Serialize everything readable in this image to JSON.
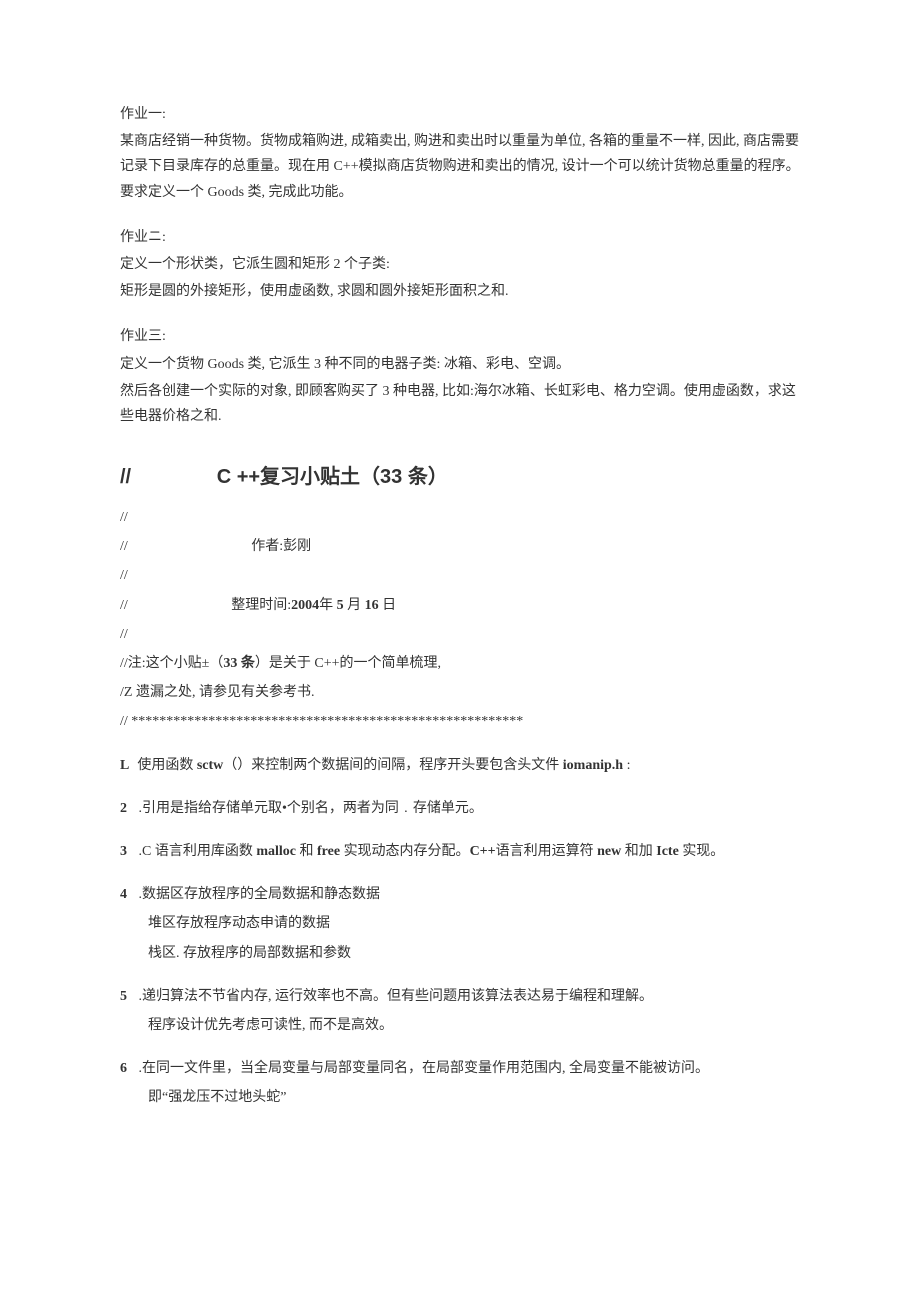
{
  "hw1": {
    "title": "作业一:",
    "body": "某商店经销一种货物。货物成箱购进, 成箱卖出, 购进和卖出时以重量为单位, 各箱的重量不一样, 因此, 商店需要记录下目录库存的总重量。现在用 C++模拟商店货物购进和卖出的情况, 设计一个可以统计货物总重量的程序。要求定义一个 Goods 类, 完成此功能。"
  },
  "hw2": {
    "title": "作业ニ:",
    "line1": "定义一个形状类，它派生圆和矩形 2 个子类:",
    "line2": "矩形是圆的外接矩形，使用虚函数, 求圆和圆外接矩形面积之和."
  },
  "hw3": {
    "title": "作业三:",
    "line1": "定义一个货物 Goods 类, 它派生 3 种不同的电器子类: 冰箱、彩电、空调。",
    "line2": "然后各创建一个实际的对象, 即顾客购买了 3 种电器, 比如:海尔冰箱、长虹彩电、格力空调。使用虚函数，求这些电器价格之和."
  },
  "tips": {
    "main_prefix": "//",
    "main_title": "C ++复习小贴土（33 条）",
    "slash1": "//",
    "author_line_prefix": " //",
    "author_text": "作者:彭刚",
    "slash2": "//",
    "time_prefix": "//",
    "time_label": "整理时间:",
    "time_value": "2004年 5 月 16 日",
    "slash3": "//",
    "note_prefix": "//注:这个小贴±（",
    "note_bold": "33 条",
    "note_suffix": "）是关于 C++的一个简单梳理,",
    "note2": "/Z 遗漏之处, 请参见有关参考书.",
    "stars": " // ********************************************************"
  },
  "items": [
    {
      "num": "L",
      "main_parts": [
        "使用函数 ",
        "sctw",
        "（）来控制两个数据间的间隔，程序开头要包含头文件 ",
        "iomanip.h",
        " :"
      ],
      "subs": []
    },
    {
      "num": "2",
      "main_parts": [
        " .引用是指给存储单元取•个别名，两者为同﹒存储单元。"
      ],
      "subs": []
    },
    {
      "num": "3",
      "main_parts": [
        " .C 语言利用库函数 ",
        "malloc",
        " 和 ",
        "free",
        " 实现动态内存分配。",
        "C++",
        "语言利用运算符 ",
        "new",
        " 和加 ",
        "Icte",
        " 实现。"
      ],
      "subs": []
    },
    {
      "num": "4",
      "main_parts": [
        " .数据区存放程序的全局数据和静态数据"
      ],
      "subs": [
        "堆区存放程序动态申请的数据",
        "栈区. 存放程序的局部数据和参数"
      ]
    },
    {
      "num": "5",
      "main_parts": [
        " .递归算法不节省内存, 运行效率也不高。但有些问题用该算法表达易于编程和理解。"
      ],
      "subs": [
        "程序设计优先考虑可读性, 而不是高效。"
      ]
    },
    {
      "num": "6",
      "main_parts": [
        " .在同一文件里，当全局变量与局部变量同名，在局部变量作用范围内, 全局变量不能被访问。"
      ],
      "subs": [
        "即“强龙压不过地头蛇”"
      ]
    }
  ]
}
